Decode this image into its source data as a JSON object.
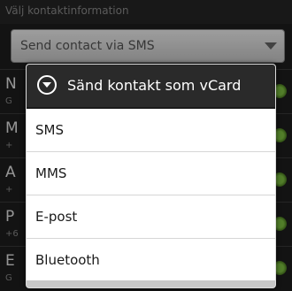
{
  "screen": {
    "header_title": "Välj kontaktinformation",
    "spinner_value": "Send contact via SMS"
  },
  "background_list": [
    {
      "initial": "N",
      "sub": "G"
    },
    {
      "initial": "M",
      "sub": "+"
    },
    {
      "initial": "A",
      "sub": "+"
    },
    {
      "initial": "P",
      "sub": "+6"
    },
    {
      "initial": "E",
      "sub": "G"
    }
  ],
  "dialog": {
    "title": "Sänd kontakt som vCard",
    "options": [
      "SMS",
      "MMS",
      "E-post",
      "Bluetooth"
    ]
  }
}
